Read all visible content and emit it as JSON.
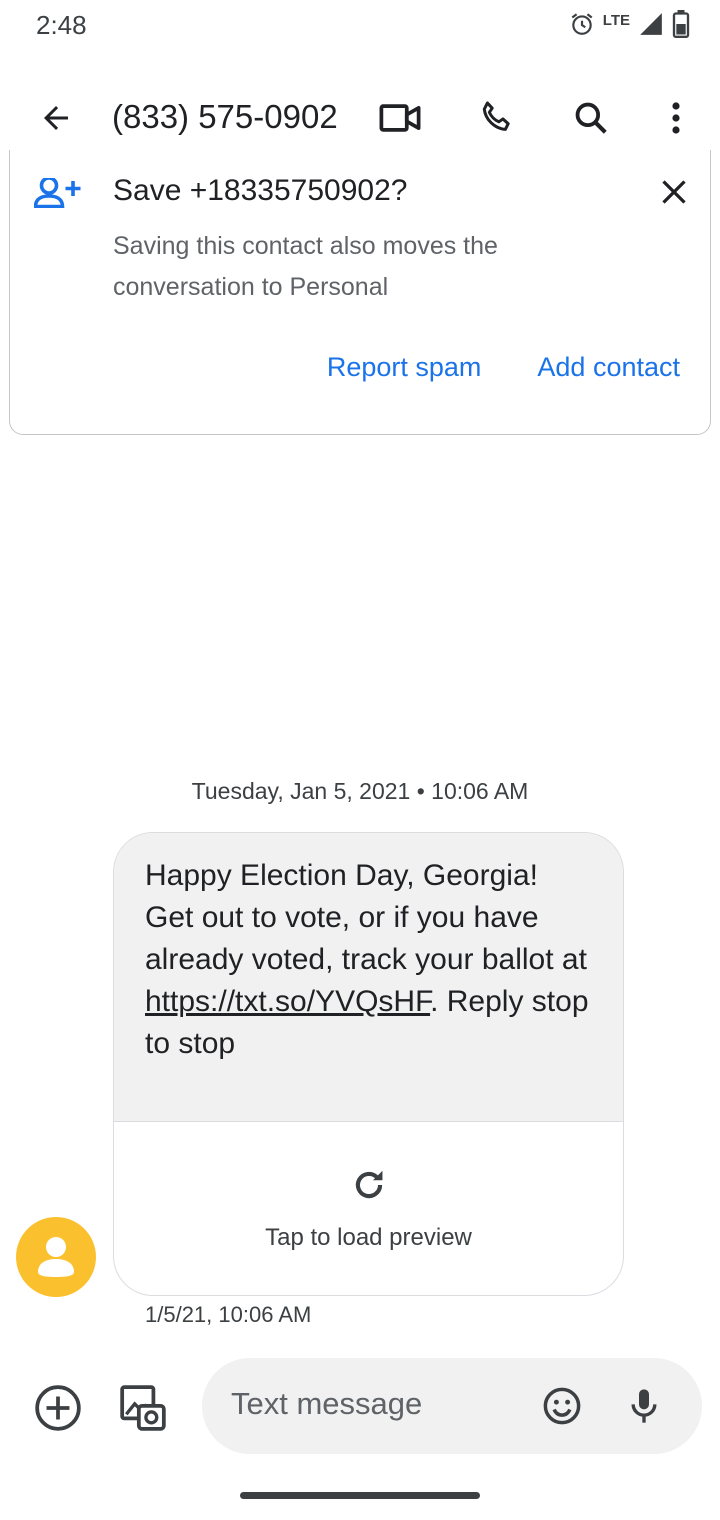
{
  "status_bar": {
    "time": "2:48",
    "network": "LTE",
    "icons": [
      "alarm-icon",
      "signal-icon",
      "battery-icon"
    ]
  },
  "app_bar": {
    "title": "(833) 575-0902",
    "icons": [
      "back-arrow-icon",
      "video-call-icon",
      "phone-icon",
      "search-icon",
      "more-vert-icon"
    ]
  },
  "contact_card": {
    "title": "Save +18335750902?",
    "body": "Saving this contact also moves the conversation to Personal",
    "report_spam": "Report spam",
    "add_contact": "Add contact",
    "icons": [
      "add-person-icon",
      "close-icon"
    ]
  },
  "conversation": {
    "date_header": "Tuesday, Jan 5, 2021 • 10:06 AM",
    "message": {
      "text_before_link": "Happy Election Day, Georgia! Get out to vote, or if you have already voted, track your ballot at ",
      "link": "https://txt.so/YVQsHF",
      "text_after_link": ". Reply stop to stop",
      "preview_label": "Tap to load preview",
      "timestamp": "1/5/21, 10:06 AM"
    }
  },
  "compose": {
    "placeholder": "Text message",
    "icons": [
      "add-circle-icon",
      "gallery-icon",
      "emoji-icon",
      "mic-icon"
    ]
  },
  "colors": {
    "accent": "#1a73e8",
    "avatar": "#fbc02d",
    "bubble": "#f1f1f1",
    "text": "#202124",
    "secondary_text": "#5f6368"
  }
}
